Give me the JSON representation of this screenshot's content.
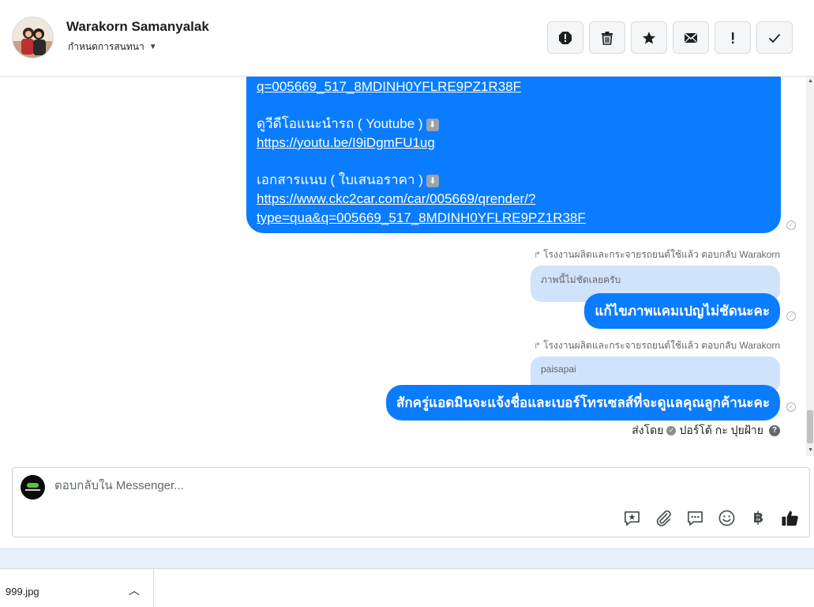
{
  "header": {
    "contact_name": "Warakorn Samanyalak",
    "subtitle": "กำหนดการสนทนา",
    "actions": [
      {
        "name": "report-button",
        "icon": "exclamation-circle-icon"
      },
      {
        "name": "delete-button",
        "icon": "trash-icon"
      },
      {
        "name": "star-button",
        "icon": "star-icon"
      },
      {
        "name": "mark-unread-button",
        "icon": "envelope-icon"
      },
      {
        "name": "important-button",
        "icon": "exclamation-icon"
      },
      {
        "name": "done-button",
        "icon": "check-icon"
      }
    ]
  },
  "messages": {
    "main": {
      "line1_link": "q=005669_517_8MDINH0YFLRE9PZ1R38F",
      "video_label": "ดูวีดีโอแนะนำรถ ( Youtube )",
      "video_link": "https://youtu.be/I9iDgmFU1ug",
      "doc_label": "เอกสารแนบ ( ใบเสนอราคา )",
      "doc_link_1": "https://www.ckc2car.com/car/005669/qrender/?",
      "doc_link_2": "type=qua&q=005669_517_8MDINH0YFLRE9PZ1R38F"
    },
    "reply1": {
      "meta": "โรงงานผลิตและกระจายรถยนต์ใช้แล้ว ตอบกลับ Warakorn",
      "quoted": "ภาพนี้ไม่ชัดเลยครับ",
      "text": "แก้ไขภาพแคมเปญไม่ชัดนะคะ"
    },
    "reply2": {
      "meta": "โรงงานผลิตและกระจายรถยนต์ใช้แล้ว ตอบกลับ Warakorn",
      "quoted": "paisapai",
      "text": "สักครู่แอดมินจะแจ้งชื่อและเบอร์โทรเซลส์ที่จะดูแลคุณลูกค้านะคะ"
    },
    "sent_by_label": "ส่งโดย",
    "sent_by_name": "ปอร์โต้ กะ ปุยฝ้าย"
  },
  "composer": {
    "placeholder": "ตอบกลับใน Messenger...",
    "tools": [
      "saved-reply-icon",
      "attachment-icon",
      "chat-bubbles-icon",
      "emoji-icon",
      "baht-icon",
      "like-icon"
    ],
    "baht_symbol": "฿"
  },
  "downloads": {
    "filename": "999.jpg"
  }
}
